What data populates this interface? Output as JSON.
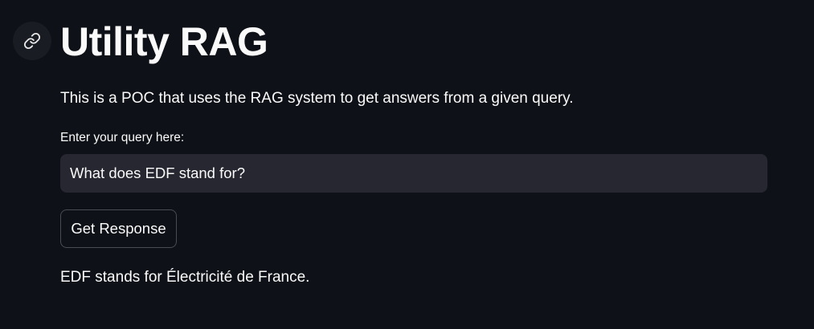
{
  "header": {
    "anchor_icon": "link-icon",
    "title": "Utility RAG"
  },
  "main": {
    "description": "This is a POC that uses the RAG system to get answers from a given query.",
    "query_label": "Enter your query here:",
    "query_value": "What does EDF stand for?",
    "button_label": "Get Response",
    "response": "EDF stands for Électricité de France."
  },
  "colors": {
    "background": "#0e1117",
    "text": "#fafafa",
    "input_background": "#262730",
    "button_border": "#4a4c55"
  }
}
